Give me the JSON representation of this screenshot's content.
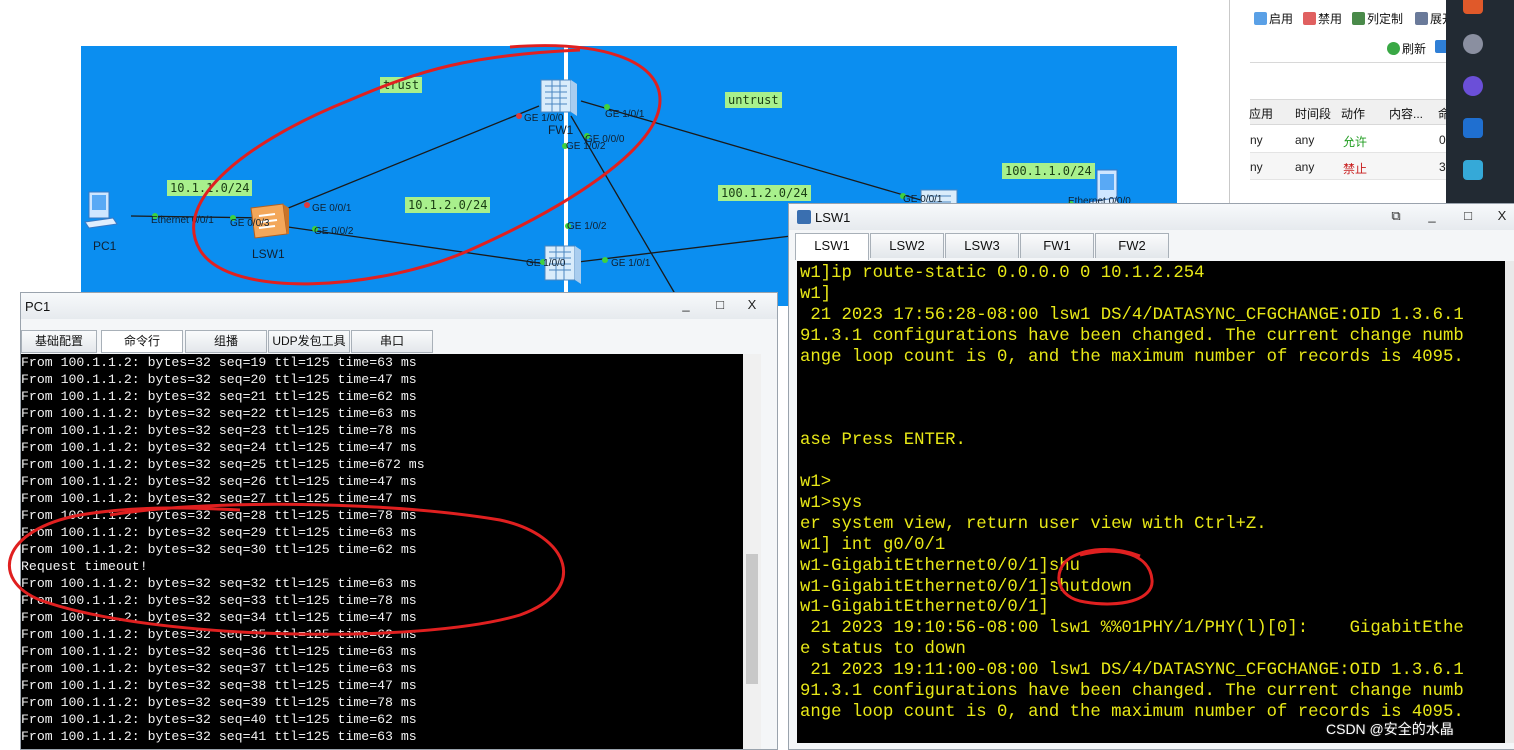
{
  "topology": {
    "zones": [
      "trust",
      "untrust"
    ],
    "networks": [
      "10.1.1.0/24",
      "10.1.2.0/24",
      "100.1.2.0/24",
      "100.1.1.0/24"
    ],
    "devices": [
      "PC1",
      "LSW1",
      "FW1"
    ],
    "ports": {
      "pc1_eth": "Ethernet 0/0/1",
      "lsw1_g003": "GE 0/0/3",
      "lsw1_g001": "GE 0/0/1",
      "lsw1_g002": "GE 0/0/2",
      "fw1_g100": "GE 1/0/0",
      "fw1_g101": "GE 1/0/1",
      "fw1_g000": "GE 0/0/0",
      "fw1_g102": "GE 1/0/2",
      "fw2_g102": "GE 1/0/2",
      "fw2_g100": "GE 1/0/0",
      "fw2_g101": "GE 1/0/1",
      "r_g001": "GE 0/0/1",
      "server_eth": "Ethernet 0/0/0"
    }
  },
  "policy_panel": {
    "toolbar": [
      "启用",
      "禁用",
      "列定制",
      "展开"
    ],
    "refresh": "刷新",
    "columns": [
      "应用",
      "时间段",
      "动作",
      "内容...",
      "命"
    ],
    "rows": [
      {
        "app": "ny",
        "time": "any",
        "action": "允许",
        "action_color": "#1f9c1f",
        "hits": "0"
      },
      {
        "app": "ny",
        "time": "any",
        "action": "禁止",
        "action_color": "#c81e1e",
        "hits": "3"
      }
    ]
  },
  "lsw1_window": {
    "title": "LSW1",
    "tabs": [
      "LSW1",
      "LSW2",
      "LSW3",
      "FW1",
      "FW2"
    ],
    "active_tab": "LSW1",
    "lines": [
      "w1]ip route-static 0.0.0.0 0 10.1.2.254",
      "w1]",
      " 21 2023 17:56:28-08:00 lsw1 DS/4/DATASYNC_CFGCHANGE:OID 1.3.6.1",
      "91.3.1 configurations have been changed. The current change numb",
      "ange loop count is 0, and the maximum number of records is 4095.",
      "",
      "",
      "",
      "ase Press ENTER.",
      "",
      "w1>",
      "w1>sys",
      "er system view, return user view with Ctrl+Z.",
      "w1] int g0/0/1",
      "w1-GigabitEthernet0/0/1]shu",
      "w1-GigabitEthernet0/0/1]shutdown",
      "w1-GigabitEthernet0/0/1]",
      " 21 2023 19:10:56-08:00 lsw1 %%01PHY/1/PHY(l)[0]:    GigabitEthe",
      "e status to down",
      " 21 2023 19:11:00-08:00 lsw1 DS/4/DATASYNC_CFGCHANGE:OID 1.3.6.1",
      "91.3.1 configurations have been changed. The current change numb",
      "ange loop count is 0, and the maximum number of records is 4095."
    ]
  },
  "pc1_window": {
    "title": "PC1",
    "tabs": [
      "基础配置",
      "命令行",
      "组播",
      "UDP发包工具",
      "串口"
    ],
    "active_tab": "命令行",
    "lines": [
      "From 100.1.1.2: bytes=32 seq=19 ttl=125 time=63 ms",
      "From 100.1.1.2: bytes=32 seq=20 ttl=125 time=47 ms",
      "From 100.1.1.2: bytes=32 seq=21 ttl=125 time=62 ms",
      "From 100.1.1.2: bytes=32 seq=22 ttl=125 time=63 ms",
      "From 100.1.1.2: bytes=32 seq=23 ttl=125 time=78 ms",
      "From 100.1.1.2: bytes=32 seq=24 ttl=125 time=47 ms",
      "From 100.1.1.2: bytes=32 seq=25 ttl=125 time=672 ms",
      "From 100.1.1.2: bytes=32 seq=26 ttl=125 time=47 ms",
      "From 100.1.1.2: bytes=32 seq=27 ttl=125 time=47 ms",
      "From 100.1.1.2: bytes=32 seq=28 ttl=125 time=78 ms",
      "From 100.1.1.2: bytes=32 seq=29 ttl=125 time=63 ms",
      "From 100.1.1.2: bytes=32 seq=30 ttl=125 time=62 ms",
      "Request timeout!",
      "From 100.1.1.2: bytes=32 seq=32 ttl=125 time=63 ms",
      "From 100.1.1.2: bytes=32 seq=33 ttl=125 time=78 ms",
      "From 100.1.1.2: bytes=32 seq=34 ttl=125 time=47 ms",
      "From 100.1.1.2: bytes=32 seq=35 ttl=125 time=62 ms",
      "From 100.1.1.2: bytes=32 seq=36 ttl=125 time=63 ms",
      "From 100.1.1.2: bytes=32 seq=37 ttl=125 time=63 ms",
      "From 100.1.1.2: bytes=32 seq=38 ttl=125 time=47 ms",
      "From 100.1.1.2: bytes=32 seq=39 ttl=125 time=78 ms",
      "From 100.1.1.2: bytes=32 seq=40 ttl=125 time=62 ms",
      "From 100.1.1.2: bytes=32 seq=41 ttl=125 time=63 ms"
    ]
  },
  "window_controls": {
    "minimize": "_",
    "maximize": "□",
    "close": "X",
    "restore": "⧉"
  },
  "watermark": "CSDN @安全的水晶",
  "icons": [
    "pc-icon",
    "switch-icon",
    "firewall-icon",
    "router-icon",
    "server-icon",
    "refresh-icon",
    "app-icon"
  ]
}
